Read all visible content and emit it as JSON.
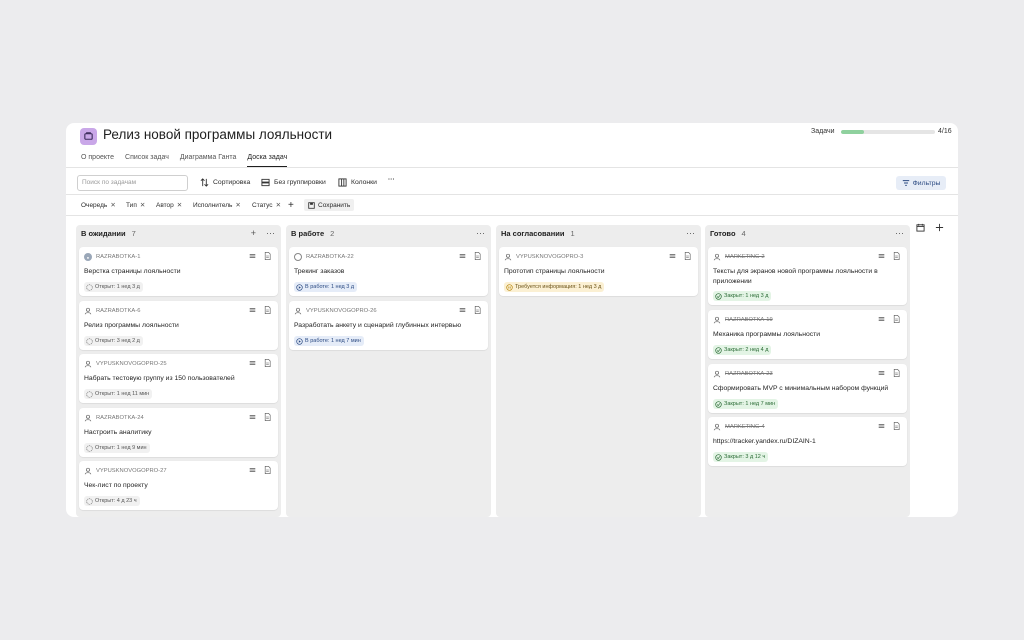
{
  "project": {
    "title": "Релиз новой программы лояльности",
    "progress_label": "Задачи",
    "progress_count": "4/16",
    "progress_fraction": 0.25
  },
  "tabs": [
    {
      "label": "О проекте"
    },
    {
      "label": "Список задач"
    },
    {
      "label": "Диаграмма Ганта"
    },
    {
      "label": "Доска задач",
      "active": true
    }
  ],
  "toolbar": {
    "search_placeholder": "Поиск по задачам",
    "sort": "Сортировка",
    "group": "Без группировки",
    "columns": "Колонки",
    "more": "···",
    "filters": "Фильтры"
  },
  "filterbar": {
    "chips": [
      "Очередь",
      "Тип",
      "Автор",
      "Исполнитель",
      "Статус"
    ],
    "add": "+",
    "save": "Сохранить"
  },
  "columns": [
    {
      "title": "В ожидании",
      "count": "7",
      "cards": [
        {
          "key": "RAZRABOTKA-1",
          "title": "Верстка страницы лояльности",
          "status": "Открыт: 1 нед 3 д",
          "type": "open"
        },
        {
          "key": "RAZRABOTKA-6",
          "title": "Релиз программы лояльности",
          "status": "Открыт: 3 нед 2 д",
          "type": "open"
        },
        {
          "key": "VYPUSKNOVOGOPRO-25",
          "title": "Набрать тестовую группу из 150 пользователей",
          "status": "Открыт: 1 нед 11 мин",
          "type": "open"
        },
        {
          "key": "RAZRABOTKA-24",
          "title": "Настроить аналитику",
          "status": "Открыт: 1 нед 9 мин",
          "type": "open"
        },
        {
          "key": "VYPUSKNOVOGOPRO-27",
          "title": "Чек-лист по проекту",
          "status": "Открыт: 4 д 23 ч",
          "type": "open"
        }
      ]
    },
    {
      "title": "В работе",
      "count": "2",
      "cards": [
        {
          "key": "RAZRABOTKA-22",
          "title": "Трекинг заказов",
          "status": "В работе: 1 нед 3 д",
          "type": "work"
        },
        {
          "key": "VYPUSKNOVOGOPRO-26",
          "title": "Разработать анкету и сценарий глубинных интервью",
          "status": "В работе: 1 нед 7 мин",
          "type": "work"
        }
      ]
    },
    {
      "title": "На согласовании",
      "count": "1",
      "cards": [
        {
          "key": "VYPUSKNOVOGOPRO-3",
          "title": "Прототип страницы лояльности",
          "status": "Требуется информация: 1 нед 3 д",
          "type": "info"
        }
      ]
    },
    {
      "title": "Готово",
      "count": "4",
      "cards": [
        {
          "key": "MARKETING-2",
          "title": "Тексты для экранов новой программы лояльности в приложении",
          "status": "Закрыт: 1 нед 3 д",
          "type": "closed"
        },
        {
          "key": "RAZRABOTKA-19",
          "title": "Механика программы лояльности",
          "status": "Закрыт: 2 нед 4 д",
          "type": "closed"
        },
        {
          "key": "RAZRABOTKA-23",
          "title": "Сформировать MVP с минимальным набором функций",
          "status": "Закрыт: 1 нед 7 мин",
          "type": "closed"
        },
        {
          "key": "MARKETING-4",
          "title": "https://tracker.yandex.ru/DIZAIN-1",
          "status": "Закрыт: 3 д 12 ч",
          "type": "closed"
        }
      ]
    }
  ],
  "colors": {
    "progress_fill": "#8fd19e",
    "accent_blue": "#2b4a82",
    "closed_green": "#2a6b35"
  }
}
